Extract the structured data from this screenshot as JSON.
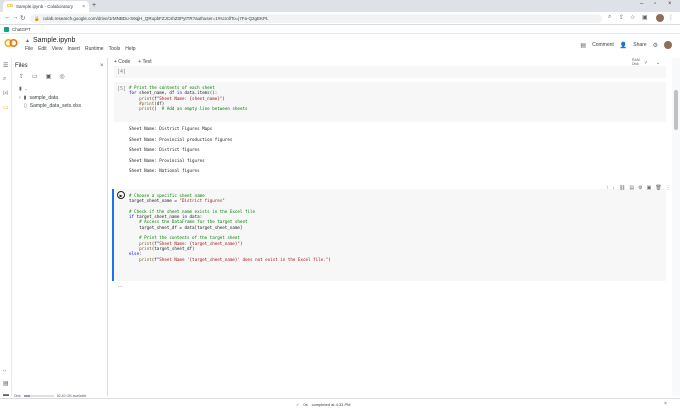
{
  "browser": {
    "tab_title": "Sample.ipynb - Colaboratory",
    "tab_close": "×",
    "new_tab": "+",
    "url": "colab.research.google.com/drive/1rMNBDu-S9qjH_QRupbFZJCshZ0PytTR?authuser=1#scrollTo=j7Fa-Q2gEKPL",
    "bookmark": "ChatGPT",
    "back": "←",
    "forward": "→",
    "reload": "↻"
  },
  "colab": {
    "notebook_title": "Sample.ipynb",
    "menu": [
      "File",
      "Edit",
      "View",
      "Insert",
      "Runtime",
      "Tools",
      "Help"
    ],
    "comment_label": "Comment",
    "share_label": "Share",
    "add_code": "+ Code",
    "add_text": "+ Text",
    "ram_label": "RAM",
    "disk_label": "Disk"
  },
  "files": {
    "title": "Files",
    "tree": [
      {
        "name": "..",
        "type": "folder"
      },
      {
        "name": "sample_data",
        "type": "folder"
      },
      {
        "name": "Sample_data_sets.xlsx",
        "type": "file"
      }
    ],
    "disk_text": "Disk",
    "disk_available": "82.40 GB available",
    "disk_used_fraction": 0.22
  },
  "cells": {
    "prev_exec": "[4]",
    "cell5_exec": "[5]",
    "cell5_lines": [
      [
        [
          "cm",
          "# Print the contents of each sheet"
        ]
      ],
      [
        [
          "kw",
          "for"
        ],
        [
          "pl",
          " sheet_name, df "
        ],
        [
          "kw",
          "in"
        ],
        [
          "pl",
          " data.items():"
        ]
      ],
      [
        [
          "pl",
          "    "
        ],
        [
          "fn",
          "print"
        ],
        [
          "pl",
          "(f\""
        ],
        [
          "st",
          "Sheet Name: {sheet_name}\""
        ],
        [
          "pl",
          ")"
        ]
      ],
      [
        [
          "pl",
          "    "
        ],
        [
          "fn",
          "#print"
        ],
        [
          "pl",
          "(df)"
        ]
      ],
      [
        [
          "pl",
          "    "
        ],
        [
          "fn",
          "print"
        ],
        [
          "pl",
          "()  "
        ],
        [
          "cm",
          "# Add an empty line between sheets"
        ]
      ]
    ],
    "outputs": [
      "Sheet Name: District Figures Maps",
      "Sheet Name: Provincial production figures",
      "Sheet Name: District figures",
      "Sheet Name: Provincial figures",
      "Sheet Name: National figures"
    ],
    "cell6_lines": [
      [
        [
          "cm",
          "# Choose a specific sheet name"
        ]
      ],
      [
        [
          "pl",
          "target_sheet_name = "
        ],
        [
          "st",
          "\"District figures\""
        ]
      ],
      [
        [
          "pl",
          ""
        ]
      ],
      [
        [
          "cm",
          "# Check if the sheet name exists in the Excel file"
        ]
      ],
      [
        [
          "kw",
          "if"
        ],
        [
          "pl",
          " target_sheet_name "
        ],
        [
          "kw",
          "in"
        ],
        [
          "pl",
          " data:"
        ]
      ],
      [
        [
          "pl",
          "    "
        ],
        [
          "cm",
          "# Access the DataFrame for the target sheet"
        ]
      ],
      [
        [
          "pl",
          "    target_sheet_df = data[target_sheet_name]"
        ]
      ],
      [
        [
          "pl",
          ""
        ]
      ],
      [
        [
          "pl",
          "    "
        ],
        [
          "cm",
          "# Print the contents of the target sheet"
        ]
      ],
      [
        [
          "pl",
          "    "
        ],
        [
          "fn",
          "print"
        ],
        [
          "pl",
          "(f\""
        ],
        [
          "st",
          "Sheet Name: {target_sheet_name}\""
        ],
        [
          "pl",
          ")"
        ]
      ],
      [
        [
          "pl",
          "    "
        ],
        [
          "fn",
          "print"
        ],
        [
          "pl",
          "(target_sheet_df)"
        ]
      ],
      [
        [
          "kw",
          "else"
        ],
        [
          "pl",
          ":"
        ]
      ],
      [
        [
          "pl",
          "    "
        ],
        [
          "fn",
          "print"
        ],
        [
          "pl",
          "(f\""
        ],
        [
          "st",
          "Sheet Name '{target_sheet_name}' does not exist in the Excel file.\""
        ],
        [
          "pl",
          ")"
        ]
      ]
    ],
    "ellipsis": "..."
  },
  "status": {
    "check": "✓",
    "duration": "0s",
    "text": "completed at 4:33 PM"
  },
  "colors": {
    "accent": "#1a73e8",
    "comment": "#008000",
    "keyword": "#0000ff",
    "string": "#a31515",
    "function": "#795e26"
  }
}
